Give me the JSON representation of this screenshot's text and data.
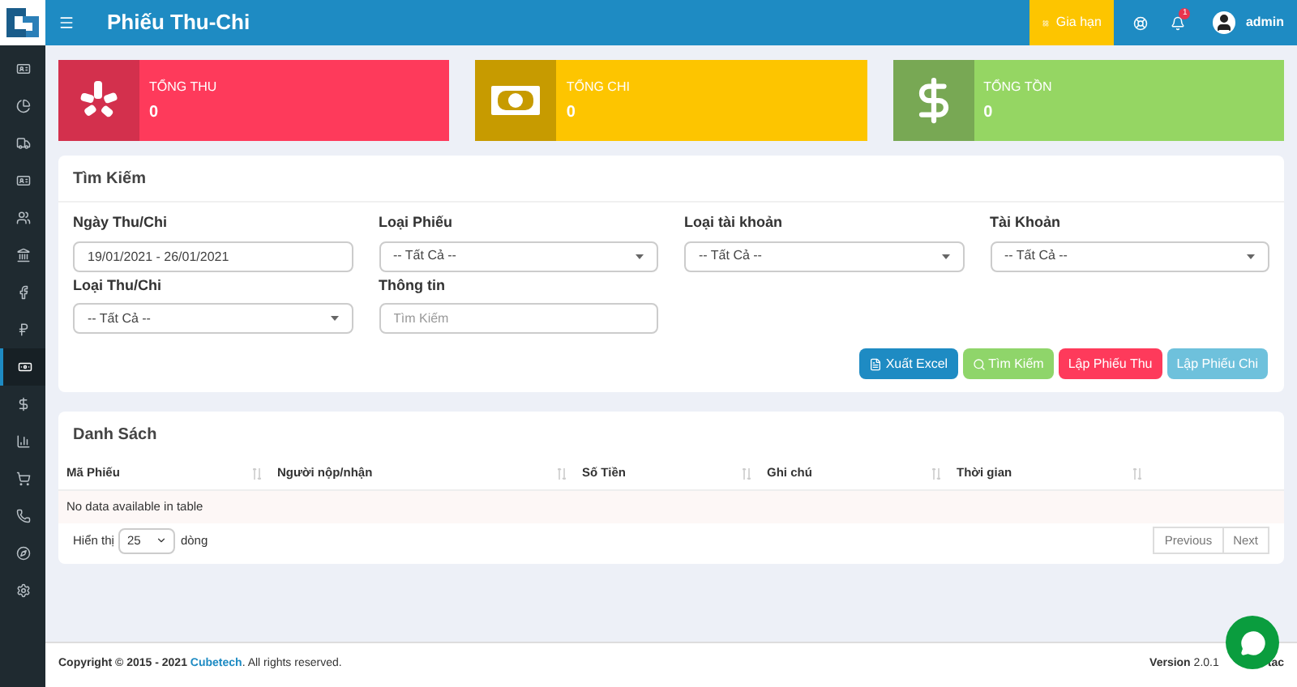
{
  "header": {
    "title": "Phiếu Thu-Chi",
    "renew_button": "Gia hạn",
    "notification_count": "1",
    "user": "admin"
  },
  "sidebar": {
    "items": [
      {
        "selected": false
      },
      {
        "selected": false
      },
      {
        "selected": false
      },
      {
        "selected": false
      },
      {
        "selected": false
      },
      {
        "selected": false
      },
      {
        "selected": false
      },
      {
        "selected": false
      },
      {
        "selected": true
      },
      {
        "selected": false
      },
      {
        "selected": false
      },
      {
        "selected": false
      },
      {
        "selected": false
      },
      {
        "selected": false
      },
      {
        "selected": false
      }
    ]
  },
  "stats": [
    {
      "kind": "income",
      "label": "TỔNG THU",
      "value": "0"
    },
    {
      "kind": "expense",
      "label": "TỔNG CHI",
      "value": "0"
    },
    {
      "kind": "balance",
      "label": "TỔNG TỒN",
      "value": "0"
    }
  ],
  "search_panel": {
    "title": "Tìm Kiếm",
    "fields": [
      {
        "kind": "input",
        "label": "Ngày Thu/Chi",
        "value": "19/01/2021 - 26/01/2021"
      },
      {
        "kind": "select",
        "label": "Loại Phiếu",
        "value": "-- Tất Cả --"
      },
      {
        "kind": "select",
        "label": "Loại tài khoản",
        "value": "-- Tất Cả --"
      },
      {
        "kind": "select",
        "label": "Tài Khoản",
        "value": "-- Tất Cả --"
      },
      {
        "kind": "select",
        "label": "Loại Thu/Chi",
        "value": "-- Tất Cả --"
      },
      {
        "kind": "input",
        "label": "Thông tin",
        "placeholder": "Tìm Kiếm"
      }
    ],
    "buttons": [
      {
        "kind": "excel",
        "label": "Xuất Excel"
      },
      {
        "kind": "search",
        "label": "Tìm Kiếm"
      },
      {
        "kind": "receipt",
        "label": "Lập Phiếu Thu"
      },
      {
        "kind": "payment",
        "label": "Lập Phiếu Chi"
      }
    ]
  },
  "list_panel": {
    "title": "Danh Sách",
    "table": {
      "columns": [
        "Mã Phiếu",
        "Người nộp/nhận",
        "Số Tiền",
        "Ghi chú",
        "Thời gian"
      ],
      "empty_message": "No data available in table"
    },
    "page_size": {
      "before": "Hiển thị",
      "value": "25",
      "after": "dòng"
    },
    "pagination": [
      "Previous",
      "Next"
    ]
  },
  "footer": {
    "copyright_prefix": "Copyright © 2015 - 2021",
    "company": "Cubetech",
    "copyright_suffix": ". All rights reserved.",
    "version_label": "Version",
    "version_value": "2.0.1",
    "version_tail": "tac"
  }
}
